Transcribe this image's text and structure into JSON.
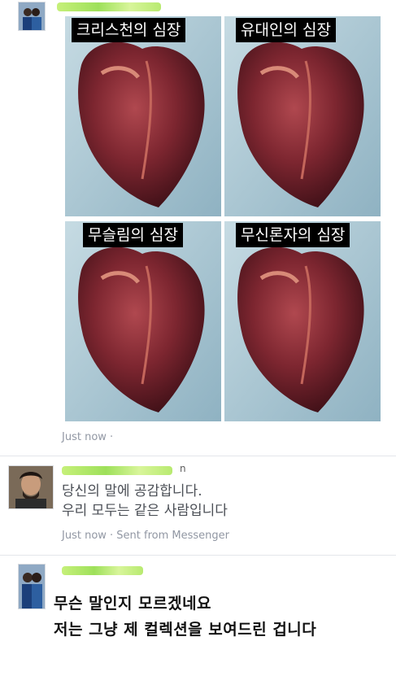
{
  "post1": {
    "name_tail": "",
    "meme": {
      "captions": [
        "크리스천의 심장",
        "유대인의 심장",
        "무슬림의 심장",
        "무신론자의 심장"
      ]
    },
    "timestamp": "Just now ·"
  },
  "post2": {
    "name_tail": "n",
    "lines": [
      "당신의 말에 공감합니다.",
      "우리 모두는 같은 사람입니다"
    ],
    "meta": "Just now · Sent from Messenger"
  },
  "post3": {
    "lines": [
      "무슨 말인지 모르겠네요",
      "저는 그냥 제 컬렉션을 보여드린 겁니다"
    ]
  },
  "colors": {
    "censor_green": "#9ee05a",
    "meta_gray": "#9197a3",
    "caption_bg": "#000000"
  }
}
